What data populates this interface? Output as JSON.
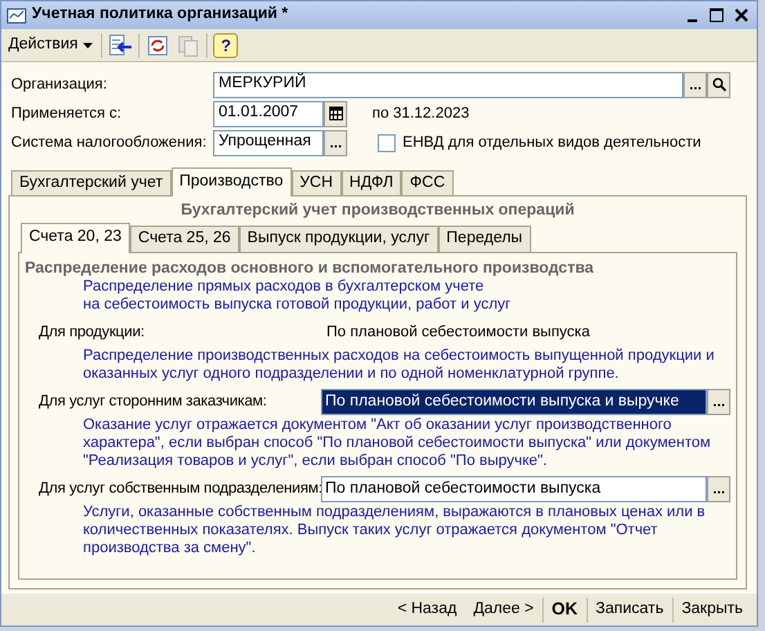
{
  "window": {
    "title": "Учетная политика организаций *"
  },
  "toolbar": {
    "actions_label": "Действия",
    "help_glyph": "?"
  },
  "form": {
    "organization": {
      "label": "Организация:",
      "value": "МЕРКУРИЙ"
    },
    "applies_from": {
      "label": "Применяется с:",
      "value": "01.01.2007",
      "until": "по 31.12.2023"
    },
    "tax_system": {
      "label": "Система налогообложения:",
      "value": "Упрощенная"
    },
    "envd": {
      "label": "ЕНВД для отдельных видов деятельности",
      "checked": false
    }
  },
  "tabs": [
    {
      "label": "Бухгалтерский учет",
      "selected": false
    },
    {
      "label": "Производство",
      "selected": true
    },
    {
      "label": "УСН",
      "selected": false
    },
    {
      "label": "НДФЛ",
      "selected": false
    },
    {
      "label": "ФСС",
      "selected": false
    }
  ],
  "section_title": "Бухгалтерский учет производственных операций",
  "subtabs": [
    {
      "label": "Счета 20, 23",
      "selected": true
    },
    {
      "label": "Счета 25, 26",
      "selected": false
    },
    {
      "label": "Выпуск продукции, услуг",
      "selected": false
    },
    {
      "label": "Переделы",
      "selected": false
    }
  ],
  "group_title": "Распределение расходов основного и вспомогательного производства",
  "intro_lines": [
    "Распределение прямых расходов в бухгалтерском учете",
    "на себестоимость выпуска готовой продукции, работ и услуг"
  ],
  "rows": [
    {
      "kind": "text",
      "label": "Для продукции:",
      "value": "По плановой себестоимости выпуска",
      "description": "Распределение производственных расходов на себестоимость выпущенной продукции и оказанных услуг одного подразделении и по одной номенклатурной группе."
    },
    {
      "kind": "select",
      "label": "Для услуг сторонним заказчикам:",
      "value": "По плановой себестоимости выпуска и выручке",
      "focused": true,
      "description": "Оказание услуг отражается документом \"Акт об оказании услуг производственного характера\", если выбран способ \"По плановой себестоимости выпуска\" или документом \"Реализация товаров и услуг\", если выбран способ \"По выручке\"."
    },
    {
      "kind": "select",
      "label": "Для услуг собственным подразделениям:",
      "value": "По плановой себестоимости выпуска",
      "focused": false,
      "description": "Услуги, оказанные собственным подразделениям, выражаются в плановых ценах или в количественных показателях. Выпуск таких услуг отражается документом \"Отчет производства за смену\"."
    }
  ],
  "footer_buttons": [
    {
      "label": "< Назад",
      "kind": "nav"
    },
    {
      "label": "Далее >",
      "kind": "nav"
    },
    {
      "label": "OK",
      "kind": "default"
    },
    {
      "label": "Записать",
      "kind": "normal"
    },
    {
      "label": "Закрыть",
      "kind": "normal"
    }
  ]
}
